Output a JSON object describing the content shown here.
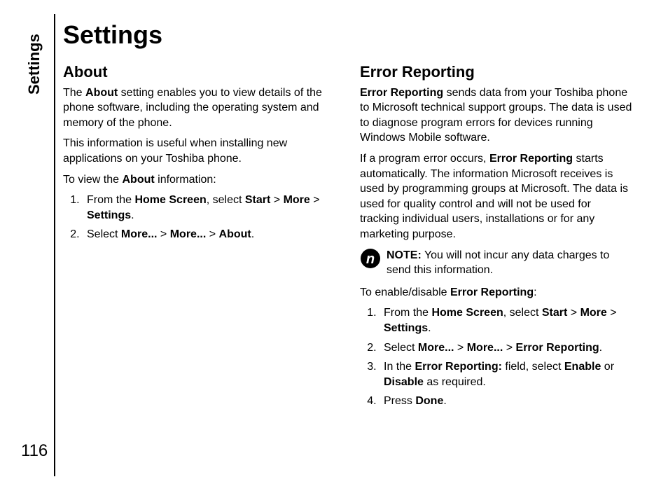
{
  "sideTab": "Settings",
  "pageNumber": "116",
  "title": "Settings",
  "left": {
    "heading": "About",
    "p1": {
      "t1": "The ",
      "b1": "About",
      "t2": " setting enables you to view details of the phone software, including the operating system and memory of the phone."
    },
    "p2": "This information is useful when installing new applications on your Toshiba phone.",
    "p3": {
      "t1": "To view the ",
      "b1": "About",
      "t2": " information:"
    },
    "li1": {
      "t1": "From the ",
      "b1": "Home Screen",
      "t2": ", select ",
      "b2": "Start",
      "t3": " > ",
      "b3": "More",
      "t4": " > ",
      "b4": "Settings",
      "t5": "."
    },
    "li2": {
      "t1": "Select ",
      "b1": "More...",
      "t2": " > ",
      "b2": "More...",
      "t3": " > ",
      "b3": "About",
      "t4": "."
    }
  },
  "right": {
    "heading": "Error Reporting",
    "p1": {
      "b1": "Error Reporting",
      "t1": " sends data from your Toshiba phone to Microsoft technical support groups. The data is used to diagnose program errors for devices running Windows Mobile software."
    },
    "p2": {
      "t1": "If a program error occurs, ",
      "b1": "Error Reporting",
      "t2": " starts automatically. The information Microsoft receives is used by programming groups at Microsoft. The data is used for quality control and will not be used for tracking individual users, installations or for any marketing purpose."
    },
    "note": {
      "b1": "NOTE:",
      "t1": " You will not incur any data charges to send this information."
    },
    "p3": {
      "t1": "To enable/disable ",
      "b1": "Error Reporting",
      "t2": ":"
    },
    "li1": {
      "t1": "From the ",
      "b1": "Home Screen",
      "t2": ", select ",
      "b2": "Start",
      "t3": " > ",
      "b3": "More",
      "t4": " > ",
      "b4": "Settings",
      "t5": "."
    },
    "li2": {
      "t1": "Select ",
      "b1": "More...",
      "t2": " > ",
      "b2": "More...",
      "t3": " > ",
      "b3": "Error Reporting",
      "t4": "."
    },
    "li3": {
      "t1": "In the ",
      "b1": "Error Reporting:",
      "t2": " field, select ",
      "b2": "Enable",
      "t3": " or ",
      "b3": "Disable",
      "t4": " as required."
    },
    "li4": {
      "t1": "Press ",
      "b1": "Done",
      "t2": "."
    }
  }
}
